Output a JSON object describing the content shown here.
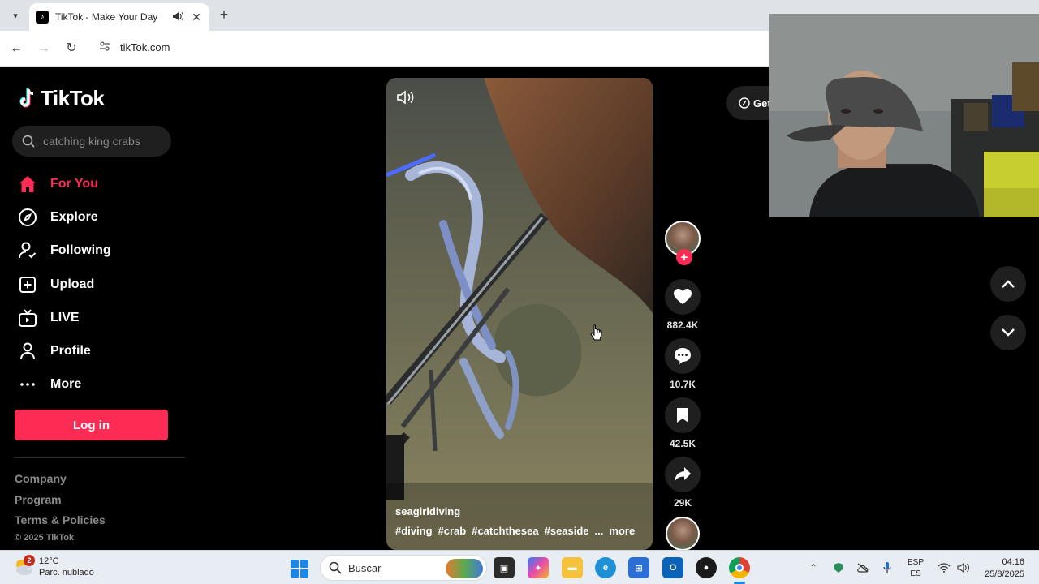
{
  "browser": {
    "tab_title": "TikTok - Make Your Day",
    "url": "tikTok.com"
  },
  "tiktok": {
    "logo_text": "TikTok",
    "search_value": "catching king crabs",
    "nav": [
      {
        "label": "For You",
        "icon": "home-icon",
        "active": true
      },
      {
        "label": "Explore",
        "icon": "compass-icon"
      },
      {
        "label": "Following",
        "icon": "following-icon"
      },
      {
        "label": "Upload",
        "icon": "upload-icon"
      },
      {
        "label": "LIVE",
        "icon": "live-icon"
      },
      {
        "label": "Profile",
        "icon": "profile-icon"
      },
      {
        "label": "More",
        "icon": "more-icon"
      }
    ],
    "login_label": "Log in",
    "footer_links": [
      "Company",
      "Program",
      "Terms & Policies"
    ],
    "copyright": "© 2025 TikTok",
    "get_app_label": "Get",
    "video": {
      "author": "seagirldiving",
      "tags": [
        "#diving",
        "#crab",
        "#catchthesea",
        "#seaside"
      ],
      "ellipsis": "...",
      "more_label": "more"
    },
    "actions": {
      "likes": "882.4K",
      "comments": "10.7K",
      "saves": "42.5K",
      "shares": "29K"
    },
    "accent_color": "#fe2c55"
  },
  "taskbar": {
    "weather_temp": "12°C",
    "weather_desc": "Parc. nublado",
    "weather_badge": "2",
    "search_label": "Buscar",
    "lang_line1": "ESP",
    "lang_line2": "ES",
    "time": "04:16",
    "date": "25/8/2025"
  }
}
